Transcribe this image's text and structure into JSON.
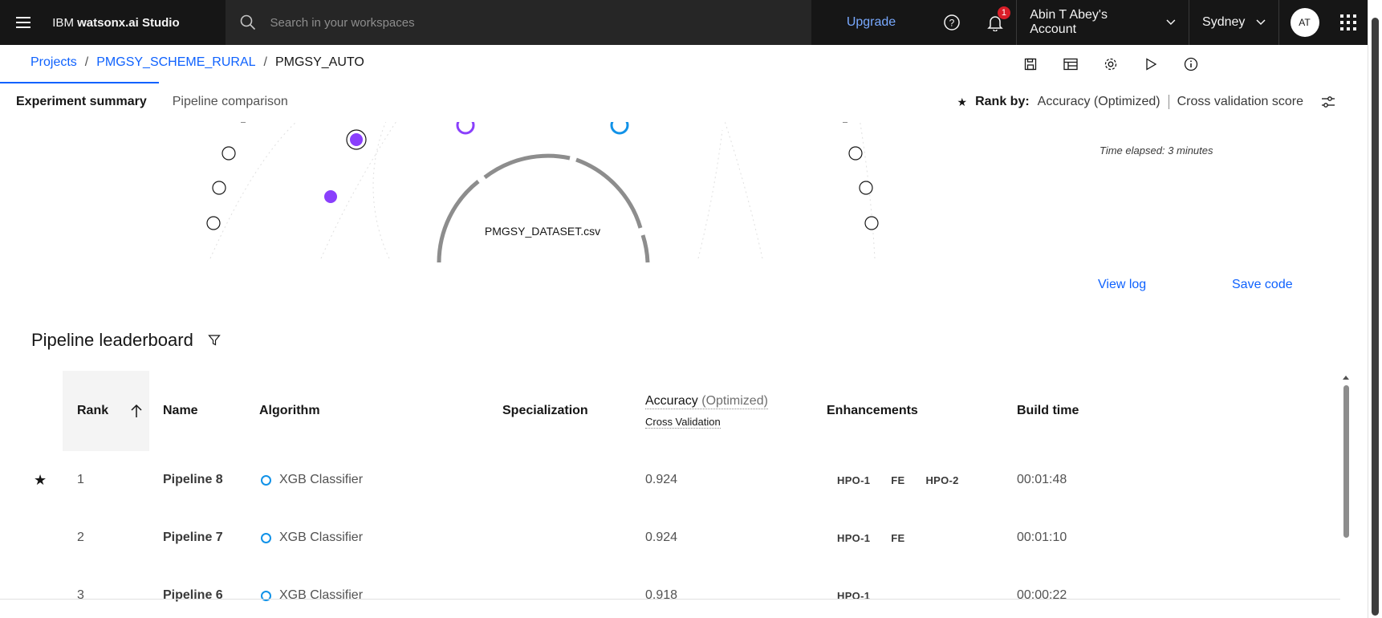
{
  "header": {
    "brand_prefix": "IBM ",
    "brand_name": "watsonx.ai Studio",
    "search_placeholder": "Search in your workspaces",
    "upgrade_label": "Upgrade",
    "notification_count": "1",
    "account_label": "Abin T Abey's Account",
    "region_label": "Sydney",
    "avatar_initials": "AT"
  },
  "breadcrumb": {
    "items": [
      "Projects",
      "PMGSY_SCHEME_RURAL",
      "PMGSY_AUTO"
    ],
    "separator": "/"
  },
  "tabs": {
    "experiment_summary": "Experiment summary",
    "pipeline_comparison": "Pipeline comparison"
  },
  "rank_by": {
    "label": "Rank by:",
    "metric": "Accuracy (Optimized)",
    "score": "Cross validation score"
  },
  "visualization": {
    "dataset_label": "PMGSY_DATASET.csv",
    "time_elapsed": "Time elapsed: 3 minutes",
    "accent_purple": "#8a3ffc",
    "accent_cyan": "#1192e8"
  },
  "actions": {
    "view_log": "View log",
    "save_code": "Save code"
  },
  "leaderboard": {
    "title": "Pipeline leaderboard",
    "columns": {
      "rank": "Rank",
      "name": "Name",
      "algorithm": "Algorithm",
      "specialization": "Specialization",
      "accuracy": "Accuracy",
      "accuracy_opt": "(Optimized)",
      "cross_validation": "Cross Validation",
      "enhancements": "Enhancements",
      "build_time": "Build time"
    },
    "rows": [
      {
        "rank": "1",
        "name": "Pipeline 8",
        "algorithm": "XGB Classifier",
        "accuracy": "0.924",
        "enh": [
          "HPO-1",
          "FE",
          "HPO-2"
        ],
        "build_time": "00:01:48"
      },
      {
        "rank": "2",
        "name": "Pipeline 7",
        "algorithm": "XGB Classifier",
        "accuracy": "0.924",
        "enh": [
          "HPO-1",
          "FE"
        ],
        "build_time": "00:01:10"
      },
      {
        "rank": "3",
        "name": "Pipeline 6",
        "algorithm": "XGB Classifier",
        "accuracy": "0.918",
        "enh": [
          "HPO-1"
        ],
        "build_time": "00:00:22"
      }
    ]
  }
}
